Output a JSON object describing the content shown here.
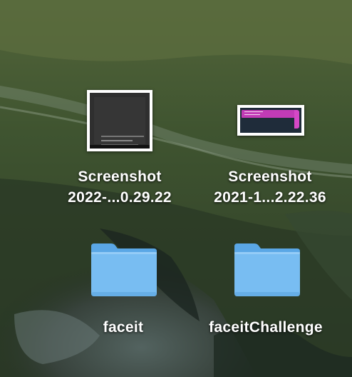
{
  "desktop": {
    "items": [
      {
        "kind": "screenshot",
        "label_line1": "Screenshot",
        "label_line2": "2022-...0.29.22"
      },
      {
        "kind": "screenshot",
        "label_line1": "Screenshot",
        "label_line2": "2021-1...2.22.36"
      },
      {
        "kind": "folder",
        "label": "faceit"
      },
      {
        "kind": "folder",
        "label": "faceitChallenge"
      }
    ]
  },
  "colors": {
    "folder_body": "#7cc1f4",
    "folder_tab": "#5aa7e6",
    "label_text": "#ffffff",
    "thumbnail_border": "#ffffff",
    "thumb2_accent": "#c23bb6"
  },
  "icons": {
    "screenshot": "screenshot-thumbnail-icon",
    "folder": "folder-icon"
  }
}
